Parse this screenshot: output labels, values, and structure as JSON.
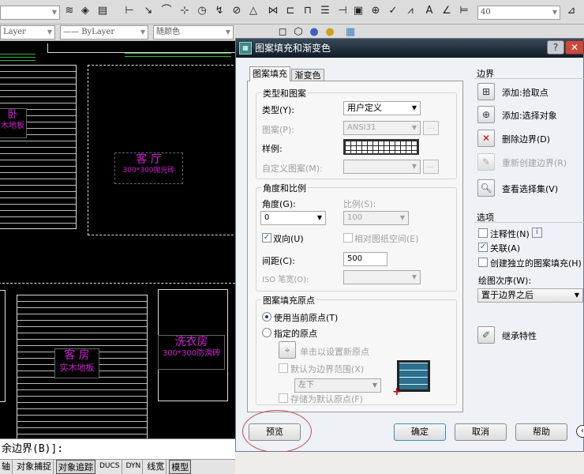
{
  "toolbar": {
    "layer_combo": "Layer",
    "linetype_combo": "ByLayer",
    "color_combo": "随颜色",
    "dimstyle_value": "40"
  },
  "drawing": {
    "rooms": [
      {
        "name": "卧",
        "floor": "木地板"
      },
      {
        "name": "客 厅",
        "floor": "300*300抛光砖"
      },
      {
        "name": "客 房",
        "floor": "实木地板"
      },
      {
        "name": "洗衣房",
        "floor": "300*300防滑砖"
      }
    ]
  },
  "command": {
    "text": "余边界(B)]:"
  },
  "status": {
    "items": [
      "轴",
      "对象捕捉",
      "对象追踪",
      "DUCS",
      "DYN",
      "线宽",
      "模型"
    ]
  },
  "dialog": {
    "title": "图案填充和渐变色",
    "help_btn": "?",
    "close_btn": "✕",
    "tabs": [
      "图案填充",
      "渐变色"
    ],
    "type_group": {
      "label": "类型和图案",
      "type_label": "类型(Y):",
      "type_value": "用户定义",
      "pattern_label": "图案(P):",
      "pattern_value": "ANSI31",
      "sample_label": "样例:",
      "custom_label": "自定义图案(M):",
      "custom_value": ""
    },
    "angle_group": {
      "label": "角度和比例",
      "angle_label": "角度(G):",
      "angle_value": "0",
      "scale_label": "比例(S):",
      "scale_value": "100",
      "double_label": "双向(U)",
      "double_checked": true,
      "relative_label": "相对图纸空间(E)",
      "relative_checked": false,
      "spacing_label": "间距(C):",
      "spacing_value": "500",
      "iso_label": "ISO 笔宽(O):",
      "iso_value": ""
    },
    "origin_group": {
      "label": "图案填充原点",
      "use_current": "使用当前原点(T)",
      "specified": "指定的原点",
      "selected": "use_current",
      "click_set": "单击以设置新原点",
      "default_extent": "默认为边界范围(X)",
      "extent_value": "左下",
      "store_default": "存储为默认原点(F)"
    },
    "boundary": {
      "label": "边界",
      "add_pick": "添加:拾取点",
      "add_select": "添加:选择对象",
      "remove": "删除边界(D)",
      "recreate": "重新创建边界(R)",
      "view_sel": "查看选择集(V)"
    },
    "options": {
      "label": "选项",
      "annotative": "注释性(N)",
      "annotative_checked": false,
      "associative": "关联(A)",
      "associative_checked": true,
      "separate": "创建独立的图案填充(H)",
      "separate_checked": false,
      "draw_order_label": "绘图次序(W):",
      "draw_order_value": "置于边界之后"
    },
    "inherit": "继承特性",
    "buttons": {
      "preview": "预览",
      "ok": "确定",
      "cancel": "取消",
      "help": "帮助"
    }
  },
  "colors": {
    "room_label": "#d020d0",
    "highlight_circle": "#c05060",
    "hatch_green": "#3cb043"
  }
}
